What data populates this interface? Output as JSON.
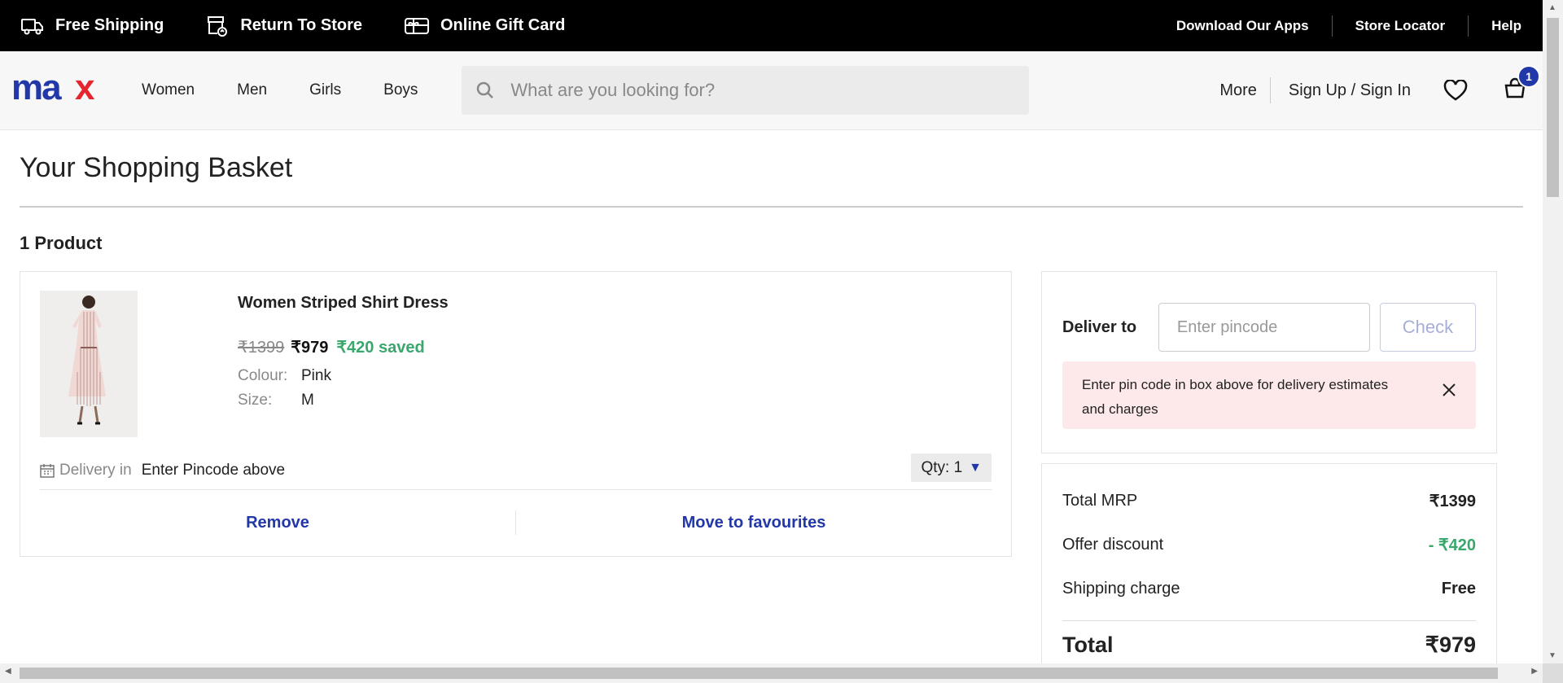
{
  "topbar": {
    "links": [
      "Free Shipping",
      "Return To Store",
      "Online Gift Card"
    ],
    "right": [
      "Download Our Apps",
      "Store Locator",
      "Help"
    ]
  },
  "header": {
    "logo": "max",
    "nav": [
      "Women",
      "Men",
      "Girls",
      "Boys"
    ],
    "search_placeholder": "What are you looking for?",
    "more": "More",
    "sign_in": "Sign Up / Sign In",
    "cart_count": "1"
  },
  "basket": {
    "title": "Your Shopping Basket",
    "product_count": "1 Product",
    "item": {
      "name": "Women Striped Shirt Dress",
      "mrp": "₹1399",
      "price": "₹979",
      "saved": "₹420 saved",
      "colour_label": "Colour:",
      "colour": "Pink",
      "size_label": "Size:",
      "size": "M",
      "delivery_label": "Delivery in",
      "delivery_value": "Enter Pincode above",
      "qty": "Qty: 1",
      "remove": "Remove",
      "move": "Move to favourites"
    }
  },
  "deliver": {
    "label": "Deliver to",
    "pincode_placeholder": "Enter pincode",
    "check": "Check",
    "alert": "Enter pin code in box above for delivery estimates and charges"
  },
  "summary": {
    "rows": [
      {
        "label": "Total MRP",
        "value": "₹1399"
      },
      {
        "label": "Offer discount",
        "value": "- ₹420"
      },
      {
        "label": "Shipping charge",
        "value": "Free"
      }
    ],
    "total_label": "Total",
    "total_value": "₹979"
  },
  "colors": {
    "brand_blue": "#2338a8",
    "brand_red": "#e5262e",
    "saved_green": "#3aa76d",
    "alert_bg": "#fde9e9"
  }
}
